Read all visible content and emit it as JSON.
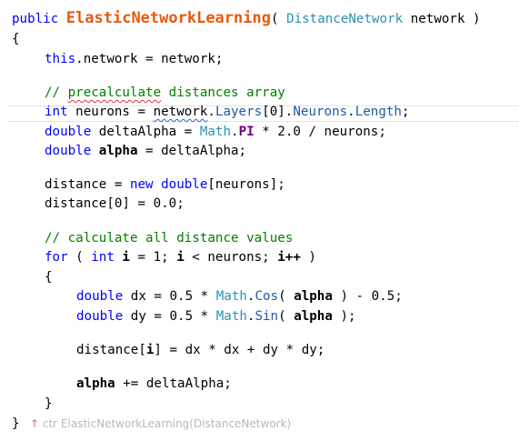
{
  "code": {
    "l01": {
      "kw_public": "public",
      "method_name": "ElasticNetworkLearning",
      "open_paren": "( ",
      "param_type": "DistanceNetwork",
      "param_rest": " network )"
    },
    "l02": {
      "brace": "{"
    },
    "l03": {
      "kw_this": "this",
      "rest": ".network = network;"
    },
    "l05": {
      "comment_prefix": "// ",
      "comment_word": "precalculate",
      "comment_rest": " distances array"
    },
    "l06": {
      "kw_int": "int",
      "pre": " neurons = ",
      "network": "network",
      "dot1": ".",
      "layers": "Layers",
      "idx": "[0].",
      "neurons_prop": "Neurons",
      "dot2": ".",
      "length": "Length",
      "semi": ";"
    },
    "l07": {
      "kw_double": "double",
      "pre": " deltaAlpha = ",
      "math": "Math",
      "dot": ".",
      "pi": "PI",
      "rest": " * 2.0 / neurons;"
    },
    "l08": {
      "kw_double": "double",
      "sp": " ",
      "alpha": "alpha",
      "rest": " = deltaAlpha;"
    },
    "l10": {
      "pre": "distance = ",
      "kw_new": "new",
      "sp": " ",
      "kw_double": "double",
      "rest": "[neurons];"
    },
    "l11": {
      "text": "distance[0] = 0.0;"
    },
    "l13": {
      "comment": "// calculate all distance values"
    },
    "l14": {
      "kw_for": "for",
      "p1": " ( ",
      "kw_int": "int",
      "sp1": " ",
      "i1": "i",
      "mid": " = 1; ",
      "i2": "i",
      "mid2": " < neurons; ",
      "i3": "i++",
      "end": " )"
    },
    "l15": {
      "brace": "{"
    },
    "l16": {
      "kw_double": "double",
      "pre": " dx = 0.5 * ",
      "math": "Math",
      "dot": ".",
      "cos": "Cos",
      "p": "( ",
      "alpha": "alpha",
      "rest": " ) - 0.5;"
    },
    "l17": {
      "kw_double": "double",
      "pre": " dy = 0.5 * ",
      "math": "Math",
      "dot": ".",
      "sin": "Sin",
      "p": "( ",
      "alpha": "alpha",
      "rest": " );"
    },
    "l19": {
      "pre": "distance[",
      "i": "i",
      "rest": "] = dx * dx + dy * dy;"
    },
    "l21": {
      "alpha": "alpha",
      "rest": " += deltaAlpha;"
    },
    "l22": {
      "brace": "}"
    },
    "l23": {
      "brace": "}"
    }
  },
  "codelens": {
    "arrow": "↑",
    "text": " ctr ElasticNetworkLearning(DistanceNetwork)"
  }
}
